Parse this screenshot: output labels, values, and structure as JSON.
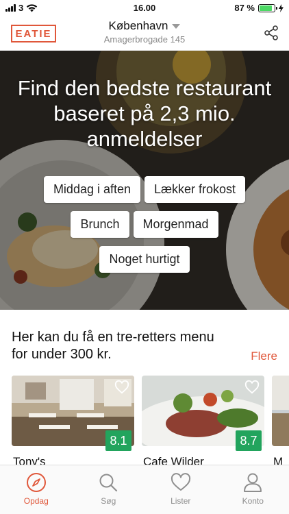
{
  "status": {
    "carrier": "3",
    "time": "16.00",
    "battery_percent": "87 %",
    "battery_level": 0.87
  },
  "header": {
    "logo": "EATIE",
    "city": "København",
    "address": "Amagerbrogade 145"
  },
  "hero": {
    "title": "Find den bedste restaurant baseret på 2,3 mio. anmeldelser",
    "chips": [
      "Middag i aften",
      "Lækker frokost",
      "Brunch",
      "Morgenmad",
      "Noget hurtigt"
    ]
  },
  "section": {
    "title": "Her kan du få en tre-retters menu for under 300 kr.",
    "more": "Flere"
  },
  "cards": [
    {
      "name": "Tony's",
      "score": "8.1"
    },
    {
      "name": "Cafe Wilder",
      "score": "8.7"
    },
    {
      "name": "M",
      "score": ""
    }
  ],
  "tabs": [
    {
      "label": "Opdag",
      "icon": "compass-icon",
      "active": true
    },
    {
      "label": "Søg",
      "icon": "search-icon",
      "active": false
    },
    {
      "label": "Lister",
      "icon": "heart-icon",
      "active": false
    },
    {
      "label": "Konto",
      "icon": "user-icon",
      "active": false
    }
  ],
  "colors": {
    "accent": "#e0573a",
    "score_green": "#22a45d",
    "battery_green": "#4cd964"
  }
}
